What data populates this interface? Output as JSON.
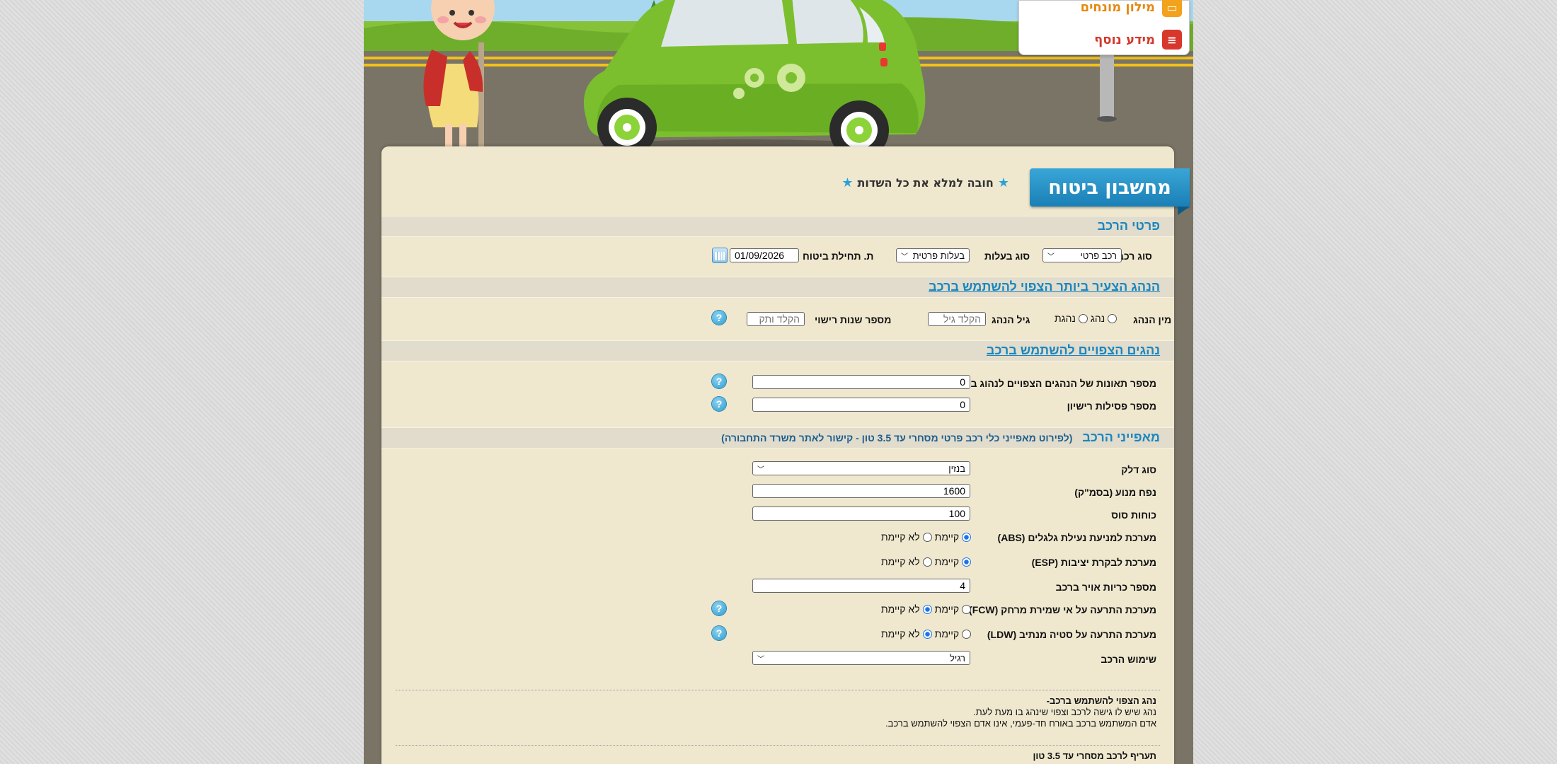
{
  "menu": {
    "dictionary_label": "מילון מונחים",
    "more_info_label": "מידע נוסף"
  },
  "calculator": {
    "title": "מחשבון ביטוח",
    "required_note": "חובה למלא את כל השדות"
  },
  "vehicle_details": {
    "heading": "פרטי הרכב",
    "vehicle_type_label": "סוג רכב",
    "vehicle_type_value": "רכב פרטי",
    "ownership_label": "סוג בעלות",
    "ownership_value": "בעלות פרטית",
    "start_date_label": "ת. תחילת ביטוח",
    "start_date_value": "01/09/2026"
  },
  "young_driver": {
    "heading": "הנהג הצעיר ביותר הצפוי להשתמש ברכב",
    "gender_label": "מין הנהג",
    "gender_male": "נהג",
    "gender_female": "נהגת",
    "age_label": "גיל הנהג",
    "age_placeholder": "הקלד גיל",
    "seniority_label": "מספר שנות רישוי",
    "seniority_placeholder": "הקלד ותק"
  },
  "expected_drivers": {
    "heading": "נהגים הצפויים להשתמש ברכב",
    "accidents_label": "מספר תאונות של הנהגים הצפויים לנהוג ברכב",
    "accidents_value": "0",
    "revocations_label": "מספר פסילות רישיון",
    "revocations_value": "0"
  },
  "vehicle_features": {
    "heading": "מאפייני הרכב",
    "subheading": "(לפירוט מאפייני כלי רכב פרטי מסחרי עד 3.5 טון - קישור לאתר משרד התחבורה)",
    "fuel_label": "סוג דלק",
    "fuel_value": "בנזין",
    "engine_label": "נפח מנוע (בסמ\"ק)",
    "engine_value": "1600",
    "hp_label": "כוחות סוס",
    "hp_value": "100",
    "abs_label": "מערכת למניעת נעילת גלגלים (ABS)",
    "esp_label": "מערכת לבקרת יציבות (ESP)",
    "airbags_label": "מספר כריות אויר ברכב",
    "airbags_value": "4",
    "fcw_label": "מערכת התרעה על אי שמירת מרחק (FCW)",
    "ldw_label": "מערכת התרעה על סטיה מנתיב (LDW)",
    "usage_label": "שימוש הרכב",
    "usage_value": "רגיל",
    "exists": "קיימת",
    "not_exists": "לא קיימת"
  },
  "notes": {
    "expected_driver_title": "נהג הצפוי להשתמש ברכב-",
    "expected_driver_line1": "נהג שיש לו גישה לרכב וצפוי שינהג בו מעת לעת.",
    "expected_driver_line2": "אדם המשתמש ברכב באורח חד-פעמי, אינו אדם הצפוי להשתמש ברכב.",
    "commercial_title": "תעריף לרכב מסחרי עד 3.5 טון"
  },
  "colors": {
    "accent": "#1a86c0",
    "panel": "#efe8cf",
    "band": "#e1dccb",
    "car_green": "#7bbf2f"
  }
}
